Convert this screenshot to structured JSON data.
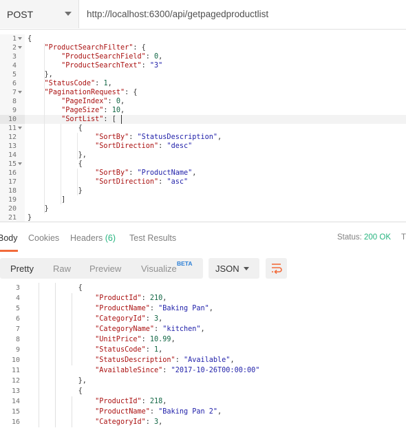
{
  "request": {
    "method": "POST",
    "url": "http://localhost:6300/api/getpagedproductlist"
  },
  "request_body": {
    "lines": [
      {
        "n": "1",
        "fold": true,
        "text": "{"
      },
      {
        "n": "2",
        "fold": true,
        "text": "    \"ProductSearchFilter\": {"
      },
      {
        "n": "3",
        "fold": false,
        "text": "        \"ProductSearchField\": 0,"
      },
      {
        "n": "4",
        "fold": false,
        "text": "        \"ProductSearchText\": \"3\""
      },
      {
        "n": "5",
        "fold": false,
        "text": "    },"
      },
      {
        "n": "6",
        "fold": false,
        "text": "    \"StatusCode\": 1,"
      },
      {
        "n": "7",
        "fold": true,
        "text": "    \"PaginationRequest\": {"
      },
      {
        "n": "8",
        "fold": false,
        "text": "        \"PageIndex\": 0,"
      },
      {
        "n": "9",
        "fold": false,
        "text": "        \"PageSize\": 10,"
      },
      {
        "n": "10",
        "fold": false,
        "text": "        \"SortList\": [",
        "active": true
      },
      {
        "n": "11",
        "fold": true,
        "text": "            {"
      },
      {
        "n": "12",
        "fold": false,
        "text": "                \"SortBy\": \"StatusDescription\","
      },
      {
        "n": "13",
        "fold": false,
        "text": "                \"SortDirection\": \"desc\""
      },
      {
        "n": "14",
        "fold": false,
        "text": "            },"
      },
      {
        "n": "15",
        "fold": true,
        "text": "            {"
      },
      {
        "n": "16",
        "fold": false,
        "text": "                \"SortBy\": \"ProductName\","
      },
      {
        "n": "17",
        "fold": false,
        "text": "                \"SortDirection\": \"asc\""
      },
      {
        "n": "18",
        "fold": false,
        "text": "            }"
      },
      {
        "n": "19",
        "fold": false,
        "text": "        ]"
      },
      {
        "n": "20",
        "fold": false,
        "text": "    }"
      },
      {
        "n": "21",
        "fold": false,
        "text": "}"
      }
    ]
  },
  "response_tabs": {
    "body": "Body",
    "cookies": "Cookies",
    "headers": "Headers",
    "headers_count": "(6)",
    "tests": "Test Results",
    "status_label": "Status:",
    "status_value": "200 OK",
    "truncated": "T"
  },
  "response_toolbar": {
    "views": [
      "Pretty",
      "Raw",
      "Preview",
      "Visualize"
    ],
    "beta_badge": "BETA",
    "format": "JSON"
  },
  "response_body": {
    "lines": [
      {
        "n": "3",
        "text": "            {"
      },
      {
        "n": "4",
        "text": "                \"ProductId\": 210,"
      },
      {
        "n": "5",
        "text": "                \"ProductName\": \"Baking Pan\","
      },
      {
        "n": "6",
        "text": "                \"CategoryId\": 3,"
      },
      {
        "n": "7",
        "text": "                \"CategoryName\": \"kitchen\","
      },
      {
        "n": "8",
        "text": "                \"UnitPrice\": 10.99,"
      },
      {
        "n": "9",
        "text": "                \"StatusCode\": 1,"
      },
      {
        "n": "10",
        "text": "                \"StatusDescription\": \"Available\","
      },
      {
        "n": "11",
        "text": "                \"AvailableSince\": \"2017-10-26T00:00:00\""
      },
      {
        "n": "12",
        "text": "            },"
      },
      {
        "n": "13",
        "text": "            {"
      },
      {
        "n": "14",
        "text": "                \"ProductId\": 218,"
      },
      {
        "n": "15",
        "text": "                \"ProductName\": \"Baking Pan 2\","
      },
      {
        "n": "16",
        "text": "                \"CategoryId\": 3,"
      }
    ]
  },
  "colors": {
    "accent": "#f26b3a",
    "success": "#26b47f",
    "beta": "#2b7fd6",
    "json_key": "#aa1111",
    "json_string": "#2222aa",
    "json_number": "#116644"
  },
  "icons": {
    "method_dropdown": "chevron-down-icon",
    "format_dropdown": "chevron-down-icon",
    "wrap": "wrap-lines-icon"
  }
}
